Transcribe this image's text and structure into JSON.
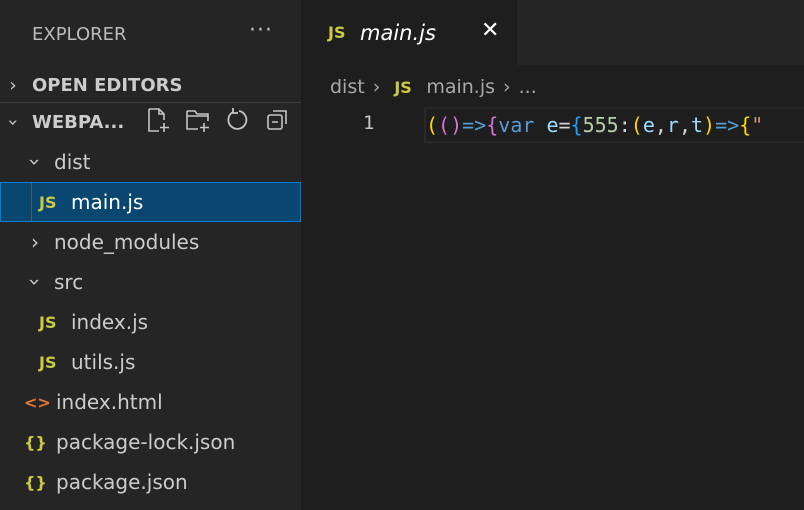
{
  "sidebar": {
    "title": "EXPLORER",
    "more": "···",
    "open_editors": "OPEN EDITORS",
    "project": "WEBPA...",
    "tree": [
      {
        "label": "dist",
        "type": "folder-open"
      },
      {
        "label": "main.js",
        "type": "js",
        "selected": true
      },
      {
        "label": "node_modules",
        "type": "folder-closed"
      },
      {
        "label": "src",
        "type": "folder-open"
      },
      {
        "label": "index.js",
        "type": "js"
      },
      {
        "label": "utils.js",
        "type": "js"
      },
      {
        "label": "index.html",
        "type": "html"
      },
      {
        "label": "package-lock.json",
        "type": "json"
      },
      {
        "label": "package.json",
        "type": "json"
      }
    ]
  },
  "icons": {
    "js": "JS",
    "html": "<>",
    "json": "{}"
  },
  "tab": {
    "label": "main.js",
    "close": "✕"
  },
  "breadcrumb": {
    "folder": "dist",
    "file": "main.js",
    "more": "..."
  },
  "editor": {
    "line_number": "1",
    "tokens": [
      {
        "t": "(",
        "c": "#ffd700"
      },
      {
        "t": "(",
        "c": "#da70d6"
      },
      {
        "t": ")",
        "c": "#da70d6"
      },
      {
        "t": "=>",
        "c": "#569cd6"
      },
      {
        "t": "{",
        "c": "#da70d6"
      },
      {
        "t": "var",
        "c": "#569cd6"
      },
      {
        "t": " ",
        "c": "#d4d4d4"
      },
      {
        "t": "e",
        "c": "#9cdcfe"
      },
      {
        "t": "=",
        "c": "#d4d4d4"
      },
      {
        "t": "{",
        "c": "#179fff"
      },
      {
        "t": "555",
        "c": "#b5cea8"
      },
      {
        "t": ":",
        "c": "#d4d4d4"
      },
      {
        "t": "(",
        "c": "#ffd700"
      },
      {
        "t": "e",
        "c": "#9cdcfe"
      },
      {
        "t": ",",
        "c": "#d4d4d4"
      },
      {
        "t": "r",
        "c": "#9cdcfe"
      },
      {
        "t": ",",
        "c": "#d4d4d4"
      },
      {
        "t": "t",
        "c": "#9cdcfe"
      },
      {
        "t": ")",
        "c": "#ffd700"
      },
      {
        "t": "=>",
        "c": "#569cd6"
      },
      {
        "t": "{",
        "c": "#ffd700"
      },
      {
        "t": "\"",
        "c": "#ce9178"
      }
    ]
  }
}
